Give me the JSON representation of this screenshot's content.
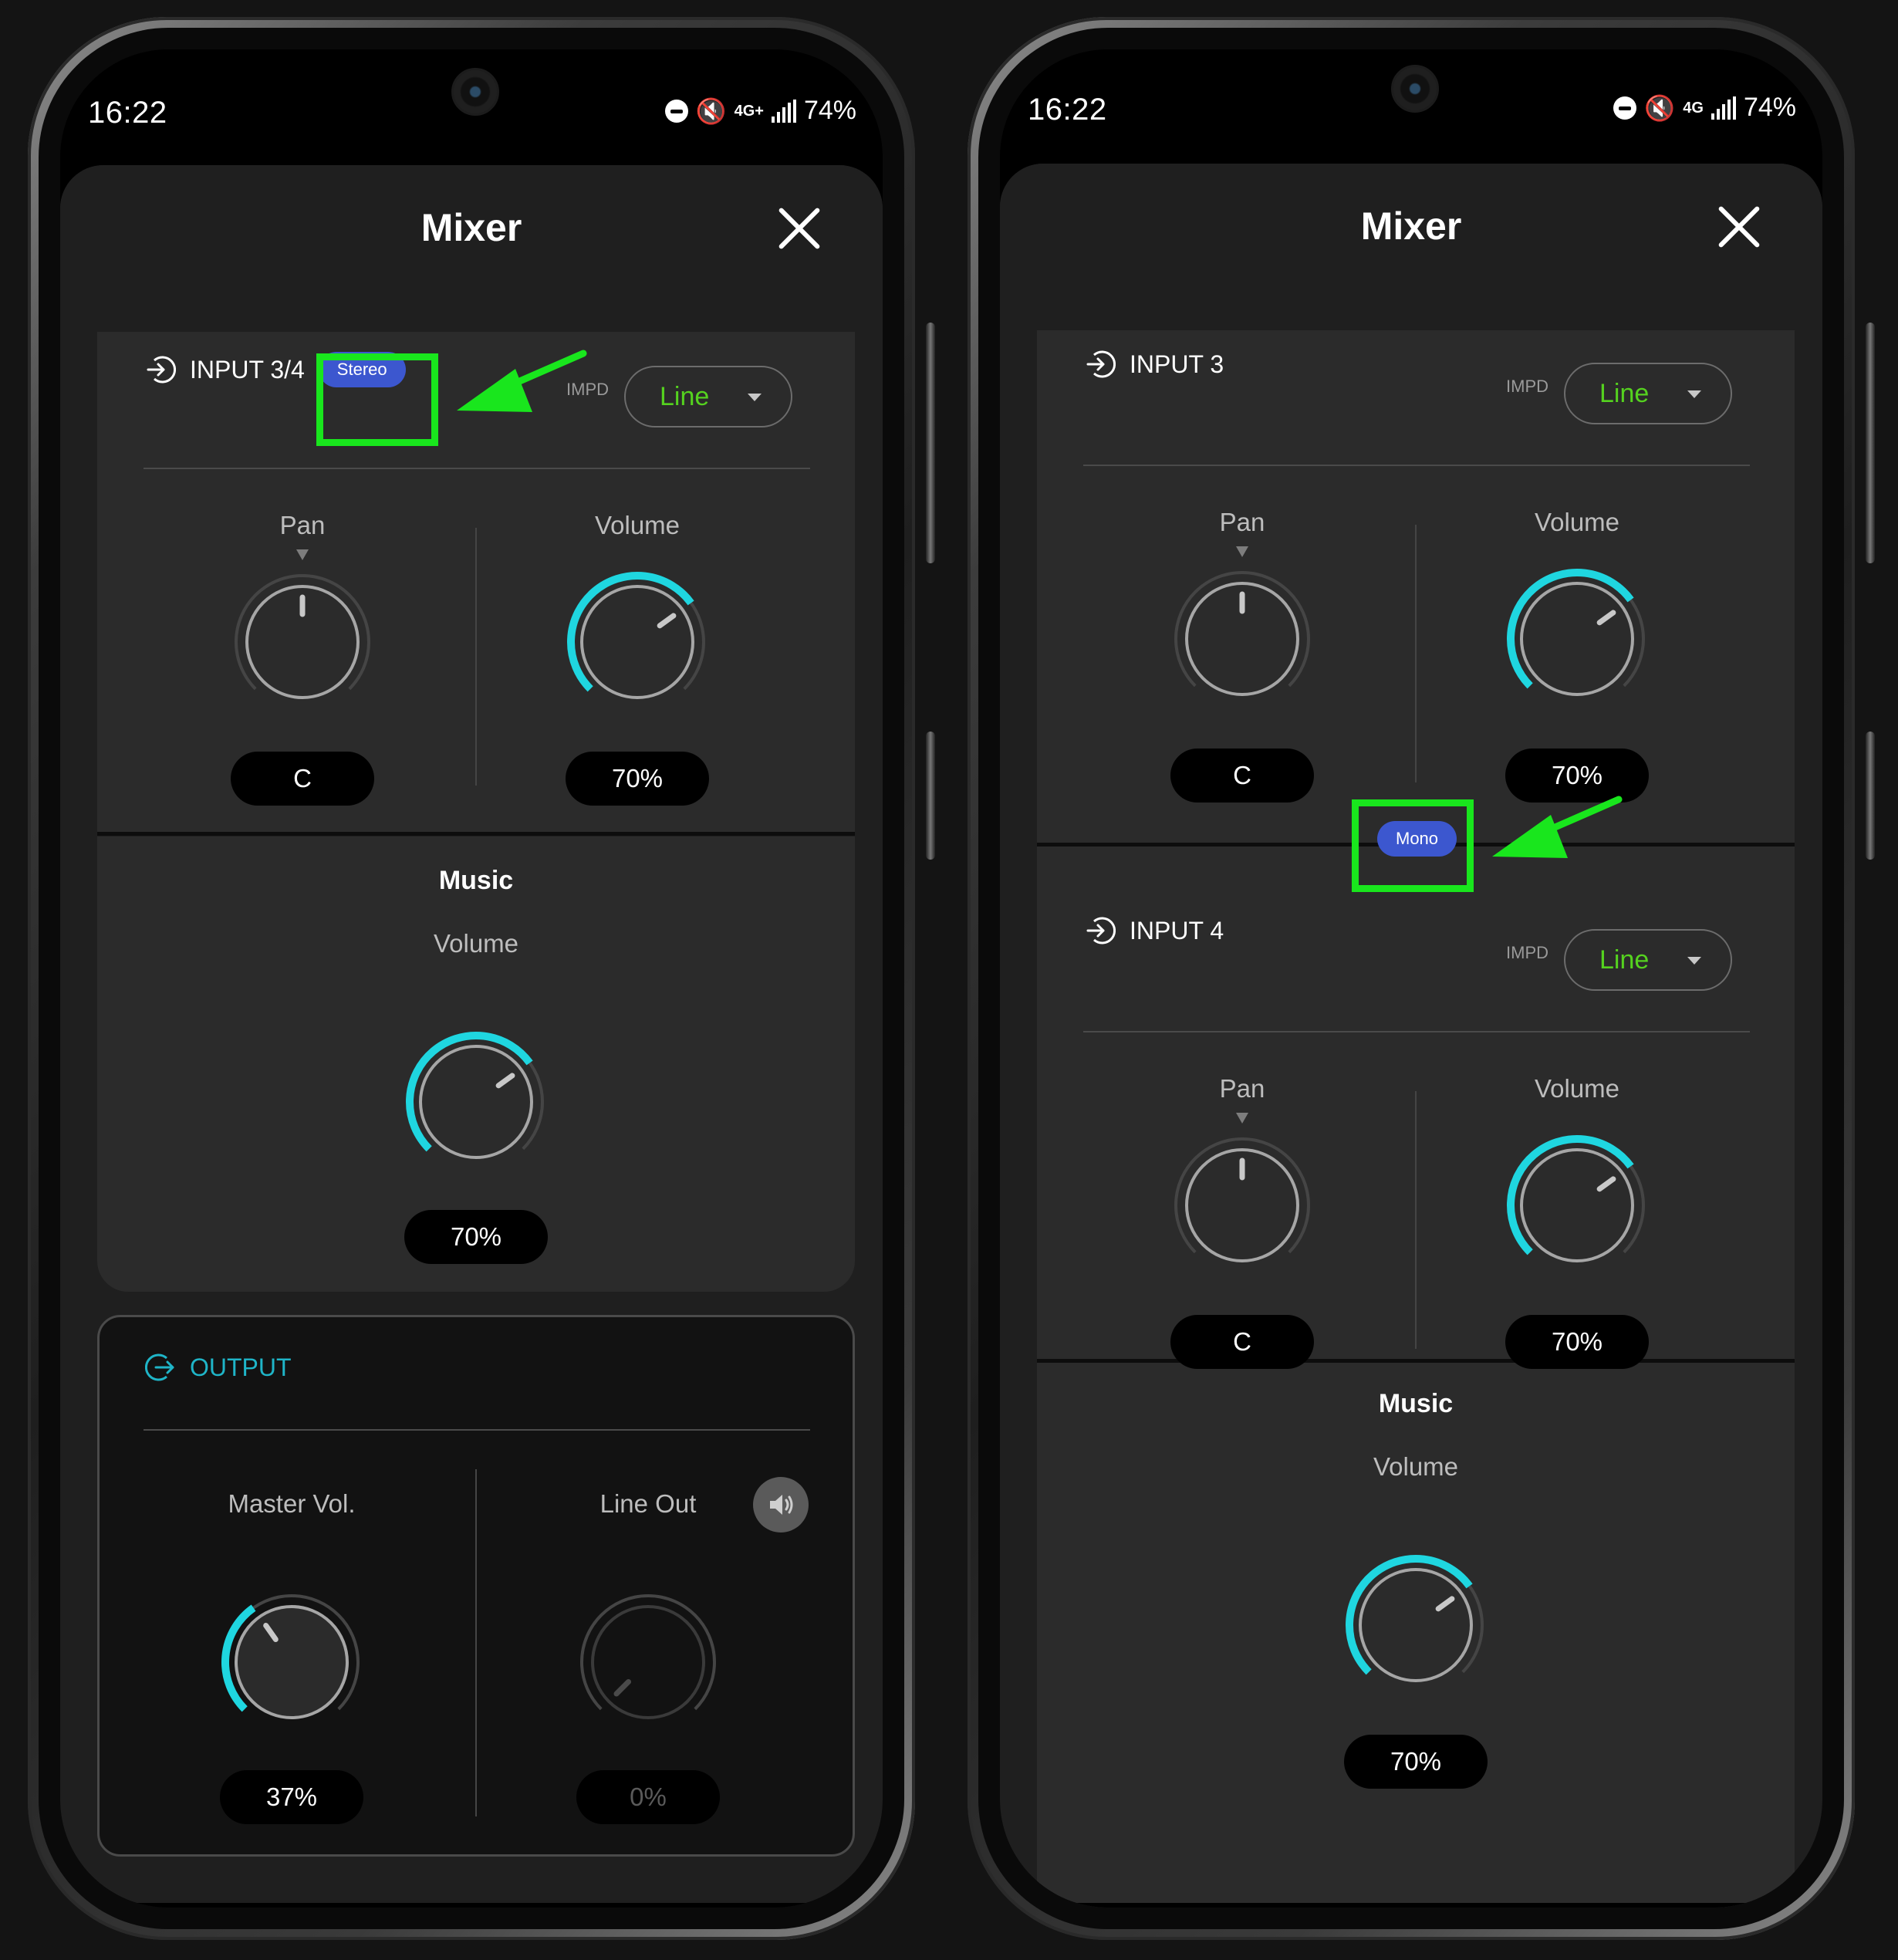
{
  "left": {
    "status": {
      "time": "16:22",
      "network": "4G+",
      "battery": "74%"
    },
    "title": "Mixer",
    "input": {
      "name": "INPUT 3/4",
      "mode_badge": "Stereo",
      "impd_label": "IMPD",
      "impd_value": "Line",
      "pan": {
        "label": "Pan",
        "value": "C",
        "level": 0.5
      },
      "volume": {
        "label": "Volume",
        "value": "70%",
        "level": 0.7
      }
    },
    "music": {
      "title": "Music",
      "volume_label": "Volume",
      "value": "70%",
      "level": 0.7
    },
    "output": {
      "name": "OUTPUT",
      "master": {
        "label": "Master Vol.",
        "value": "37%",
        "level": 0.37
      },
      "line_out": {
        "label": "Line Out",
        "value": "0%",
        "level": 0.0
      }
    }
  },
  "right": {
    "status": {
      "time": "16:22",
      "network": "4G",
      "battery": "74%"
    },
    "title": "Mixer",
    "input3": {
      "name": "INPUT 3",
      "impd_label": "IMPD",
      "impd_value": "Line",
      "pan": {
        "label": "Pan",
        "value": "C",
        "level": 0.5
      },
      "volume": {
        "label": "Volume",
        "value": "70%",
        "level": 0.7
      }
    },
    "mode_badge": "Mono",
    "input4": {
      "name": "INPUT 4",
      "impd_label": "IMPD",
      "impd_value": "Line",
      "pan": {
        "label": "Pan",
        "value": "C",
        "level": 0.5
      },
      "volume": {
        "label": "Volume",
        "value": "70%",
        "level": 0.7
      }
    },
    "music": {
      "title": "Music",
      "volume_label": "Volume",
      "value": "70%",
      "level": 0.7
    }
  },
  "colors": {
    "accent": "#1fd6e0",
    "impd_text": "#55d21f",
    "badge": "#3c57cf",
    "highlight": "#19e61d",
    "output_heading": "#1fb5c8"
  },
  "icons": [
    "input-arrow-icon",
    "output-arrow-icon",
    "close-icon",
    "chevron-down-icon",
    "speaker-icon",
    "dnd-icon",
    "mute-icon",
    "signal-icon"
  ]
}
